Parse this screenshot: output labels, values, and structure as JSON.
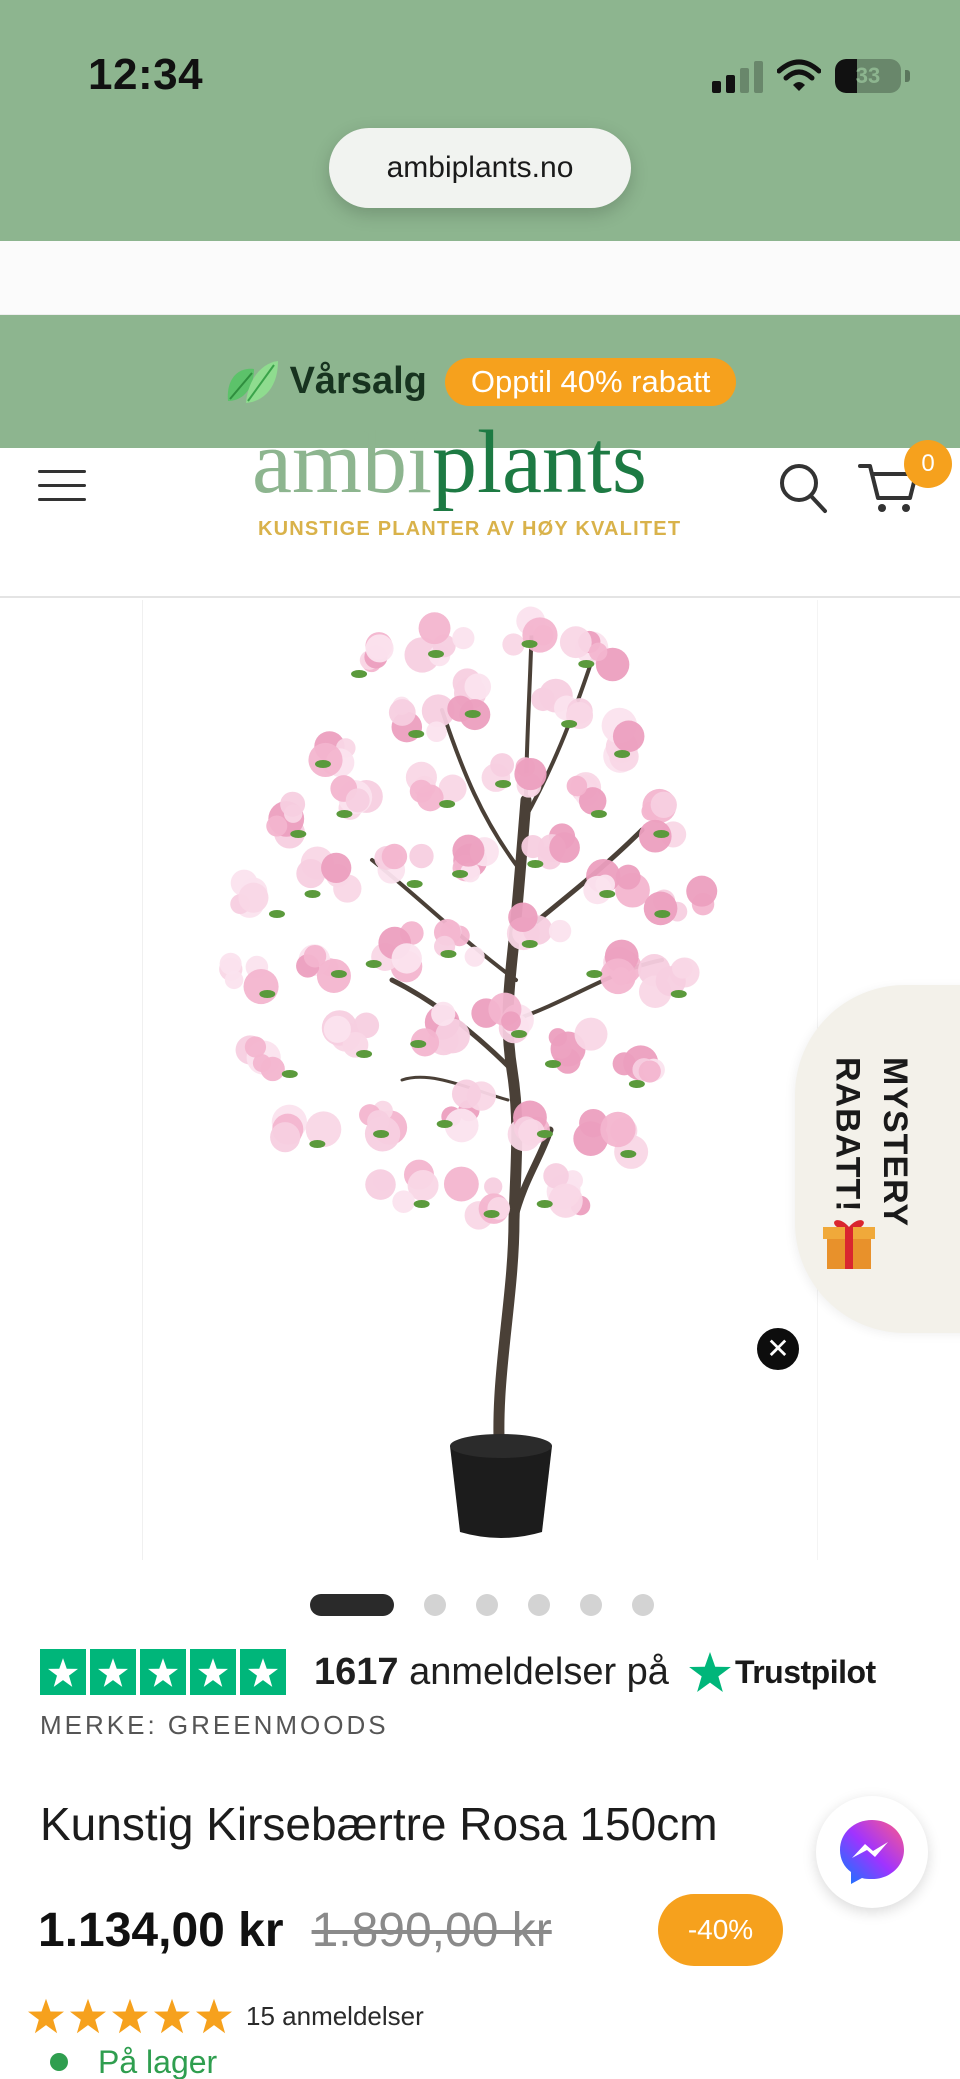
{
  "status_bar": {
    "time": "12:34",
    "battery": "33",
    "battery_level": 0.33,
    "icons": [
      "cellular-signal-icon",
      "wifi-icon",
      "battery-icon"
    ]
  },
  "browser": {
    "url": "ambiplants.no"
  },
  "promo": {
    "title": "Vårsalg",
    "badge": "Opptil 40% rabatt",
    "icon": "leaf-icon"
  },
  "header": {
    "logo_part1": "ambi",
    "logo_part2": "plants",
    "tagline": "KUNSTIGE PLANTER AV HØY KVALITET",
    "cart_count": "0",
    "icons": [
      "menu-icon",
      "search-icon",
      "cart-icon"
    ]
  },
  "gallery": {
    "mystery_label_1": "MYSTERY",
    "mystery_label_2": "RABATT!",
    "close_symbol": "✕",
    "total_slides": 6,
    "active_slide": 1
  },
  "trustpilot": {
    "count": "1617",
    "text": "anmeldelser på",
    "brand": "Trustpilot",
    "stars": 5
  },
  "product": {
    "brand_line": "MERKE: GREENMOODS",
    "title": "Kunstig Kirsebærtre Rosa 150cm",
    "price": "1.134,00 kr",
    "old_price": "1.890,00 kr",
    "discount": "-40%",
    "rating_stars": 5,
    "reviews": "15 anmeldelser",
    "stock": "På lager"
  },
  "colors": {
    "sage": "#8db58f",
    "brand_green": "#1d7a43",
    "orange": "#f6a11d",
    "trustpilot_green": "#00b67a",
    "stock_green": "#2f9e4f"
  }
}
